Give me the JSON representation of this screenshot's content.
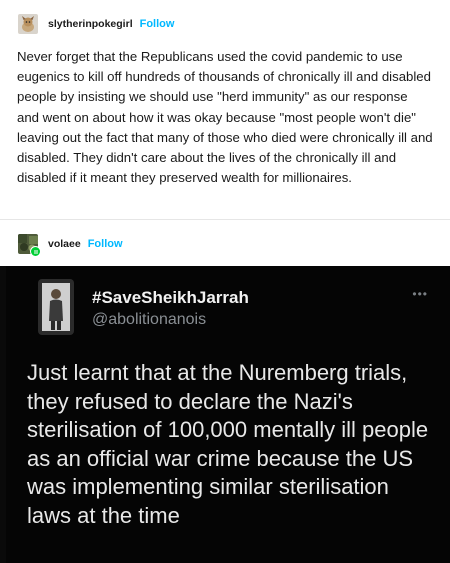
{
  "post": {
    "username": "slytherinpokegirl",
    "follow_label": "Follow",
    "body": "Never forget that the Republicans used the covid pandemic to use eugenics to kill off hundreds of thousands of chronically ill and disabled people by insisting we should use \"herd immunity\" as our response and went on about how it was okay because \"most people won't die\" leaving out the fact that many of those who died were chronically ill and disabled. They didn't care about the lives of the chronically ill and disabled if it meant they preserved wealth for millionaires."
  },
  "reblog": {
    "username": "volaee",
    "follow_label": "Follow"
  },
  "tweet": {
    "display_name": "#SaveSheikhJarrah",
    "handle": "@abolitionanois",
    "more_icon": "•••",
    "text": "Just learnt that at the Nuremberg trials, they refused to declare the Nazi's sterilisation of 100,000 mentally ill people as an official war crime because the US was implementing similar sterilisation laws at the time"
  },
  "colors": {
    "follow": "#00b8ff",
    "tweet_background": "#050505",
    "badge": "#00cf35"
  },
  "icons": {
    "post_avatar": "dog-avatar-icon",
    "reblog_avatar": "avatar-icon",
    "reblog_badge": "reblog-badge-icon"
  }
}
